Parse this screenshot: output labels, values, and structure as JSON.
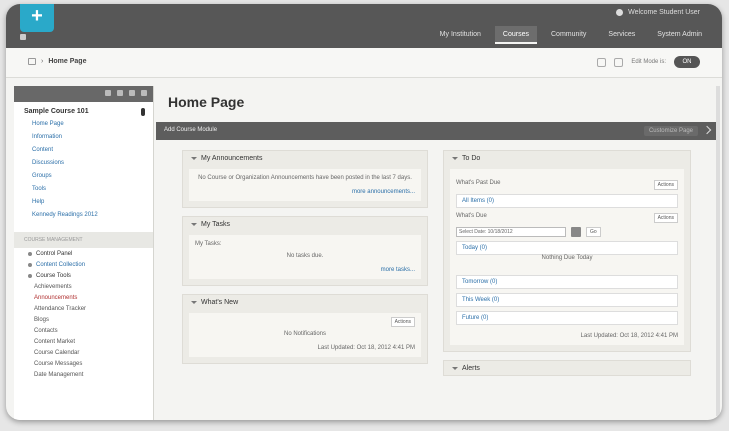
{
  "app": {
    "logo": "+",
    "user": "Welcome Student User",
    "nav_tabs": [
      {
        "label": "My Institution",
        "active": false
      },
      {
        "label": "Courses",
        "active": true
      },
      {
        "label": "Community",
        "active": false
      },
      {
        "label": "Services",
        "active": false
      },
      {
        "label": "System Admin",
        "active": false
      }
    ]
  },
  "breadcrumb": {
    "items": [
      "Home Page"
    ],
    "edit_mode_label": "Edit Mode is:",
    "edit_mode_value": "ON"
  },
  "sidebar": {
    "course_title": "Sample Course 101",
    "menu": [
      "Home Page",
      "Information",
      "Content",
      "Discussions",
      "Groups",
      "Tools",
      "Help",
      "Kennedy Readings 2012"
    ],
    "section_label": "COURSE MANAGEMENT",
    "control_panel": [
      {
        "label": "Control Panel",
        "style": "head"
      },
      {
        "label": "Content Collection",
        "style": "link"
      },
      {
        "label": "Course Tools",
        "style": "head"
      },
      {
        "label": "Achievements",
        "style": "sub"
      },
      {
        "label": "Announcements",
        "style": "badge"
      },
      {
        "label": "Attendance Tracker",
        "style": "sub"
      },
      {
        "label": "Blogs",
        "style": "sub"
      },
      {
        "label": "Contacts",
        "style": "sub"
      },
      {
        "label": "Content Market",
        "style": "sub"
      },
      {
        "label": "Course Calendar",
        "style": "sub"
      },
      {
        "label": "Course Messages",
        "style": "sub"
      },
      {
        "label": "Date Management",
        "style": "sub"
      }
    ]
  },
  "main": {
    "title": "Home Page",
    "add_module": "Add Course Module",
    "customize": "Customize Page",
    "left_modules": [
      {
        "title": "My Announcements",
        "text": "No Course or Organization Announcements have been posted in the last 7 days.",
        "link": "more announcements..."
      },
      {
        "title": "My Tasks",
        "label": "My Tasks:",
        "text": "No tasks due.",
        "link": "more tasks..."
      },
      {
        "title": "What's New",
        "select": "Actions",
        "text": "No Notifications",
        "footer": "Last Updated: Oct 18, 2012 4:41 PM"
      }
    ],
    "right_modules": [
      {
        "title": "To Do",
        "section1": "What's Past Due",
        "select1": "Actions",
        "past_due": "All Items (0)",
        "section2": "What's Due",
        "select2": "Actions",
        "date_select": "Select Date: 10/18/2012",
        "go": "Go",
        "today": "Today (0)",
        "today_text": "Nothing Due Today",
        "due_items": [
          "Tomorrow (0)",
          "This Week (0)",
          "Future (0)"
        ],
        "footer": "Last Updated: Oct 18, 2012 4:41 PM"
      },
      {
        "title": "Alerts"
      }
    ]
  }
}
